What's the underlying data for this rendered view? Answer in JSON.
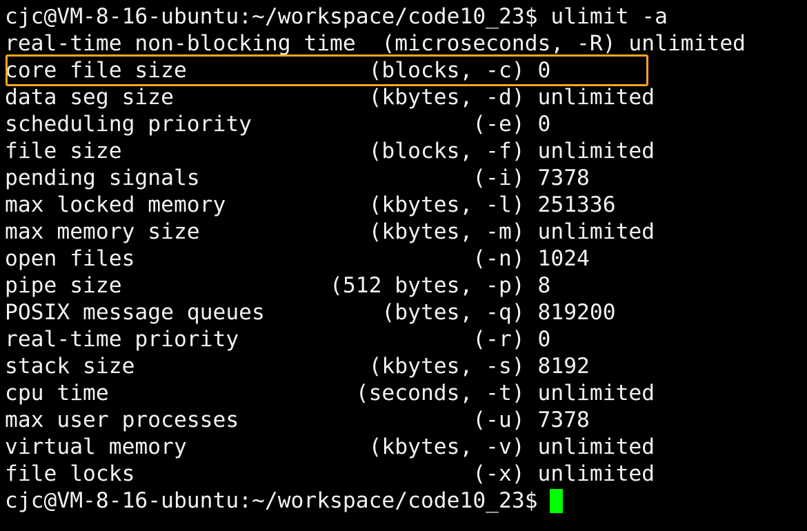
{
  "terminal": {
    "prompt_line_1": "cjc@VM-8-16-ubuntu:~/workspace/code10_23$ ulimit -a",
    "output_lines": [
      "real-time non-blocking time  (microseconds, -R) unlimited",
      "core file size              (blocks, -c) 0",
      "data seg size               (kbytes, -d) unlimited",
      "scheduling priority                 (-e) 0",
      "file size                   (blocks, -f) unlimited",
      "pending signals                     (-i) 7378",
      "max locked memory           (kbytes, -l) 251336",
      "max memory size             (kbytes, -m) unlimited",
      "open files                          (-n) 1024",
      "pipe size                (512 bytes, -p) 8",
      "POSIX message queues         (bytes, -q) 819200",
      "real-time priority                  (-r) 0",
      "stack size                  (kbytes, -s) 8192",
      "cpu time                   (seconds, -t) unlimited",
      "max user processes                  (-u) 7378",
      "virtual memory              (kbytes, -v) unlimited",
      "file locks                          (-x) unlimited"
    ],
    "prompt_line_2": "cjc@VM-8-16-ubuntu:~/workspace/code10_23$"
  },
  "colors": {
    "background": "#000000",
    "text": "#f2f2f2",
    "cursor": "#00ff00",
    "highlight": "#f5a81d"
  }
}
